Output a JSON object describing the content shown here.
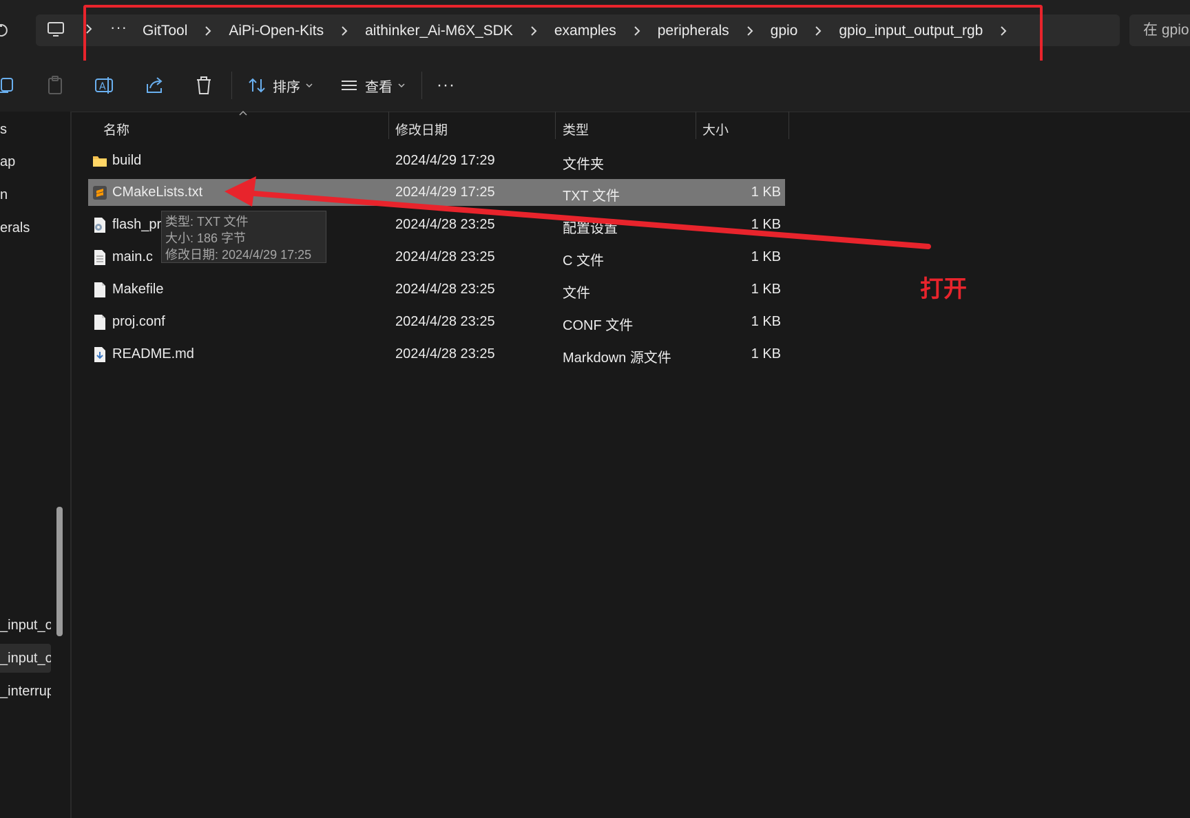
{
  "address_bar": {
    "overflow": "···",
    "crumbs": [
      "GitTool",
      "AiPi-Open-Kits",
      "aithinker_Ai-M6X_SDK",
      "examples",
      "peripherals",
      "gpio",
      "gpio_input_output_rgb"
    ],
    "search_placeholder": "在 gpio"
  },
  "toolbar": {
    "sort_label": "排序",
    "view_label": "查看",
    "more_label": "···"
  },
  "sidebar": {
    "items": [
      "s",
      "ap",
      "n",
      "erals",
      "_input_ou",
      "_input_ou",
      "_interrup"
    ],
    "selected_index": 5
  },
  "columns": {
    "name": "名称",
    "date": "修改日期",
    "type": "类型",
    "size": "大小"
  },
  "files": [
    {
      "name": "build",
      "date": "2024/4/29 17:29",
      "type": "文件夹",
      "size": "",
      "icon": "folder-icon"
    },
    {
      "name": "CMakeLists.txt",
      "date": "2024/4/29 17:25",
      "type": "TXT 文件",
      "size": "1 KB",
      "icon": "sublime-text-file-icon",
      "selected": true
    },
    {
      "name": "flash_prog_cfg.ini",
      "date": "2024/4/28 23:25",
      "type": "配置设置",
      "size": "1 KB",
      "icon": "settings-file-icon"
    },
    {
      "name": "main.c",
      "date": "2024/4/28 23:25",
      "type": "C 文件",
      "size": "1 KB",
      "icon": "text-file-icon"
    },
    {
      "name": "Makefile",
      "date": "2024/4/28 23:25",
      "type": "文件",
      "size": "1 KB",
      "icon": "blank-file-icon"
    },
    {
      "name": "proj.conf",
      "date": "2024/4/28 23:25",
      "type": "CONF 文件",
      "size": "1 KB",
      "icon": "blank-file-icon"
    },
    {
      "name": "README.md",
      "date": "2024/4/28 23:25",
      "type": "Markdown 源文件",
      "size": "1 KB",
      "icon": "markdown-file-icon"
    }
  ],
  "tooltip": {
    "type_line": "类型: TXT 文件",
    "size_line": "大小: 186 字节",
    "date_line": "修改日期: 2024/4/29 17:25"
  },
  "annotation": {
    "label": "打开",
    "color": "#e8242c"
  },
  "colors": {
    "background": "#191919",
    "selection": "#777777",
    "highlight": "#e8242c",
    "folder": "#f4c14f"
  }
}
